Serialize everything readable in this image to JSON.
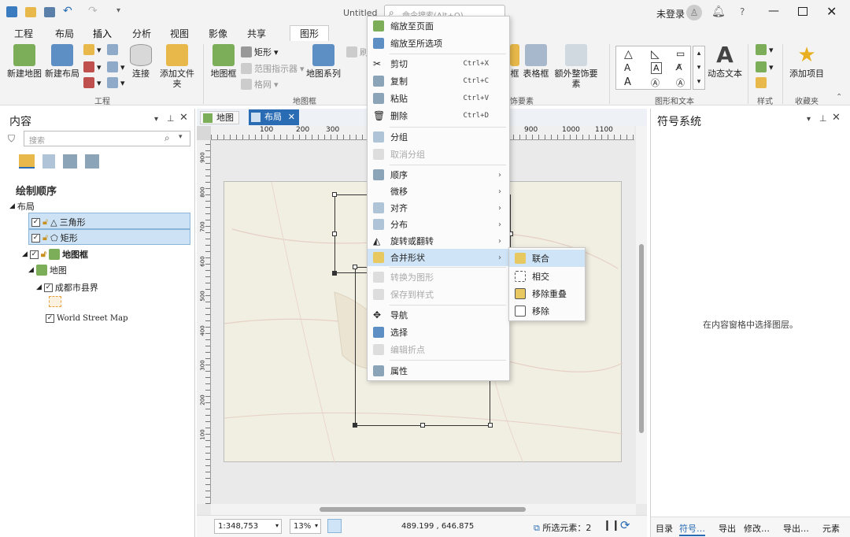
{
  "titlebar": {
    "doc_title": "Untitled",
    "search_placeholder": "命令搜索(Alt+Q)",
    "user": "未登录",
    "help": "?"
  },
  "ribbon_tabs": [
    "工程",
    "布局",
    "插入",
    "分析",
    "视图",
    "影像",
    "共享",
    "图形"
  ],
  "ribbon": {
    "new_map": "新建地图",
    "new_layout": "新建布局",
    "connect": "连接",
    "add_folder": "添加文件夹",
    "map_frame": "地图框",
    "rectangle": "矩形",
    "extent_indicator": "范围指示器",
    "grid": "格网",
    "map_series": "地图系列",
    "refresh": "刷",
    "table_frame": "表格框",
    "extra_frame": "框",
    "add_extra": "额外整饰要素",
    "dynamic_text": "动态文本",
    "add_item": "添加项目",
    "groups": {
      "project": "工程",
      "map_frame": "地图框",
      "surround": "饰要素",
      "graphics_text": "图形和文本",
      "style": "样式",
      "favorites": "收藏夹"
    }
  },
  "contents": {
    "title": "内容",
    "search_placeholder": "搜索",
    "draw_order": "绘制顺序",
    "tree": {
      "layout": "布局",
      "triangle": "三角形",
      "rectangle": "矩形",
      "map_frame": "地图框",
      "map": "地图",
      "chengdu": "成都市县界",
      "world_street": "World Street Map"
    }
  },
  "view_tabs": {
    "map": "地图",
    "layout": "布局"
  },
  "ruler": {
    "top": [
      "100",
      "200",
      "300",
      "900",
      "1000",
      "1100"
    ],
    "left": [
      "900",
      "800",
      "700",
      "600",
      "500",
      "400",
      "300",
      "200",
      "100"
    ]
  },
  "status": {
    "scale": "1:348,753",
    "zoom": "13%",
    "coords": "489.199 , 646.875",
    "selected": "所选元素：2"
  },
  "context_menu": [
    {
      "label": "缩放至页面",
      "shortcut": "",
      "disabled": false
    },
    {
      "label": "缩放至所选项",
      "shortcut": "",
      "disabled": false
    },
    {
      "label": "剪切",
      "shortcut": "Ctrl+X",
      "disabled": false
    },
    {
      "label": "复制",
      "shortcut": "Ctrl+C",
      "disabled": false
    },
    {
      "label": "粘贴",
      "shortcut": "Ctrl+V",
      "disabled": false
    },
    {
      "label": "删除",
      "shortcut": "Ctrl+D",
      "disabled": false
    },
    {
      "label": "分组",
      "shortcut": "",
      "disabled": false
    },
    {
      "label": "取消分组",
      "shortcut": "",
      "disabled": true
    },
    {
      "label": "顺序",
      "shortcut": "",
      "disabled": false
    },
    {
      "label": "微移",
      "shortcut": "",
      "disabled": false
    },
    {
      "label": "对齐",
      "shortcut": "",
      "disabled": false
    },
    {
      "label": "分布",
      "shortcut": "",
      "disabled": false
    },
    {
      "label": "旋转或翻转",
      "shortcut": "",
      "disabled": false
    },
    {
      "label": "合并形状",
      "shortcut": "",
      "disabled": false
    },
    {
      "label": "转换为图形",
      "shortcut": "",
      "disabled": true
    },
    {
      "label": "保存到样式",
      "shortcut": "",
      "disabled": true
    },
    {
      "label": "导航",
      "shortcut": "",
      "disabled": false
    },
    {
      "label": "选择",
      "shortcut": "",
      "disabled": false
    },
    {
      "label": "编辑折点",
      "shortcut": "",
      "disabled": true
    },
    {
      "label": "属性",
      "shortcut": "",
      "disabled": false
    }
  ],
  "submenu": [
    "联合",
    "相交",
    "移除重叠",
    "移除"
  ],
  "symbology": {
    "title": "符号系统",
    "empty_msg": "在内容窗格中选择图层。"
  },
  "bottom_tabs": [
    "目录",
    "符号…",
    "导出",
    "修改…",
    "导出…",
    "元素"
  ],
  "colors": {
    "accent": "#2a6cb3",
    "highlight": "#cfe4f7",
    "tree_selected": "#cde3f5"
  }
}
